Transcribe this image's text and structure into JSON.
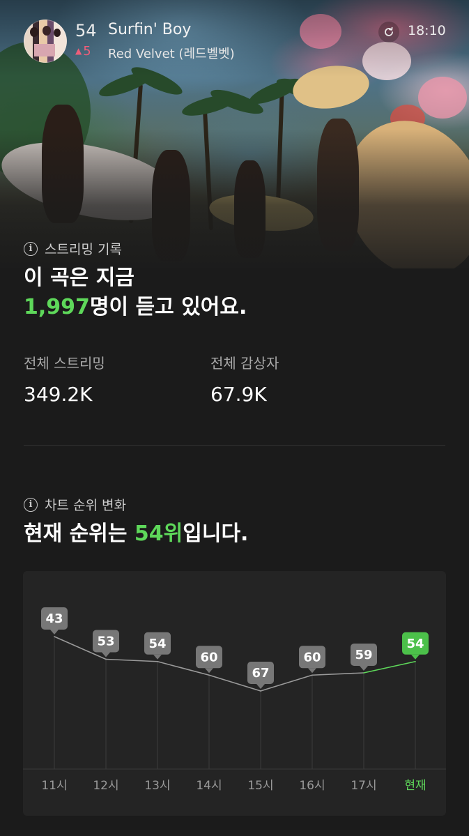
{
  "header": {
    "rank": "54",
    "rank_change": "5",
    "rank_change_direction": "up",
    "song_title": "Surfin' Boy",
    "artist": "Red Velvet (레드벨벳)",
    "time": "18:10",
    "refresh_icon": "refresh-icon"
  },
  "streaming": {
    "section_label": "스트리밍 기록",
    "headline_line1": "이 곡은 지금",
    "listeners_count": "1,997",
    "headline_line2_suffix": "명이 듣고 있어요.",
    "total_streams_label": "전체 스트리밍",
    "total_streams_value": "349.2K",
    "total_listeners_label": "전체 감상자",
    "total_listeners_value": "67.9K"
  },
  "chart_section": {
    "section_label": "차트 순위 변화",
    "headline_prefix": "현재 순위는 ",
    "headline_rank": "54위",
    "headline_suffix": "입니다."
  },
  "colors": {
    "accent_green": "#5ed85a",
    "rank_up": "#ee5e7a",
    "background": "#1b1b1b",
    "card": "#242424"
  },
  "chart_data": {
    "type": "line",
    "categories": [
      "11시",
      "12시",
      "13시",
      "14시",
      "15시",
      "16시",
      "17시",
      "현재"
    ],
    "values": [
      43,
      53,
      54,
      60,
      67,
      60,
      59,
      54
    ],
    "y_inverted": true,
    "data_labels": [
      "43",
      "53",
      "54",
      "60",
      "67",
      "60",
      "59",
      "54"
    ],
    "highlight_last": true
  }
}
